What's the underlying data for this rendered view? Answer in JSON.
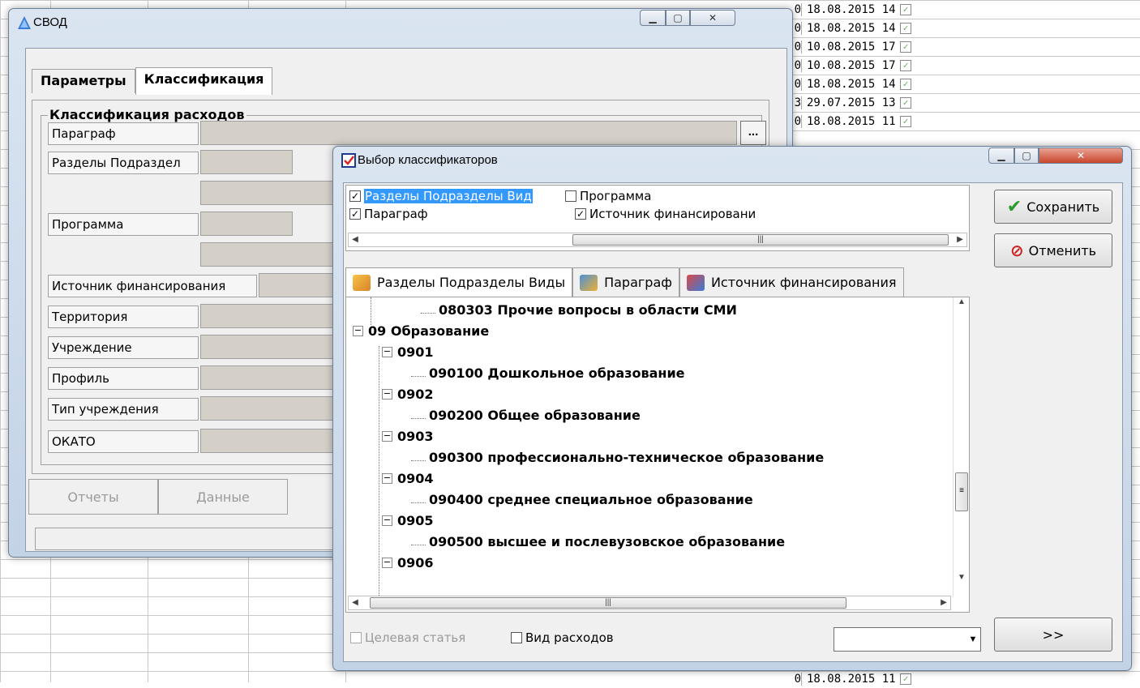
{
  "background": {
    "rows": [
      {
        "num": "0",
        "date": "18.08.2015 14"
      },
      {
        "num": "0",
        "date": "18.08.2015 14"
      },
      {
        "num": "0",
        "date": "10.08.2015 17"
      },
      {
        "num": "0",
        "date": "10.08.2015 17"
      },
      {
        "num": "0",
        "date": "18.08.2015 14"
      },
      {
        "num": "3",
        "date": "29.07.2015 13"
      },
      {
        "num": "0",
        "date": "18.08.2015 11"
      }
    ],
    "bottom_row": {
      "num": "0",
      "date": "18.08.2015 11"
    }
  },
  "svod": {
    "title": "СВОД",
    "tabs": [
      "Параметры",
      "Классификация"
    ],
    "group_title": "Классификация расходов",
    "fields": {
      "paragraph": "Параграф",
      "sections": "Разделы Подраздел",
      "program": "Программа",
      "source": "Источник финансирования",
      "territory": "Территория",
      "institution": "Учреждение",
      "profile": "Профиль",
      "inst_type": "Тип учреждения",
      "okato": "ОКАТО"
    },
    "dots": "...",
    "bottom_buttons": {
      "reports": "Отчеты",
      "data": "Данные"
    }
  },
  "vybor": {
    "title": "Выбор классификаторов",
    "checks": {
      "sections": "Разделы Подразделы Вид",
      "program": "Программа",
      "paragraph": "Параграф",
      "source": "Источник финансировани"
    },
    "tabs": [
      "Разделы Подразделы Виды",
      "Параграф",
      "Источник финансирования"
    ],
    "tree": {
      "n080303": "080303 Прочие вопросы в области СМИ",
      "n09": "09 Образование",
      "n0901": "0901",
      "n090100": "090100 Дошкольное образование",
      "n0902": "0902",
      "n090200": "090200 Общее образование",
      "n0903": "0903",
      "n090300": "090300 профессионально-техническое образование",
      "n0904": "0904",
      "n090400": "090400 среднее специальное образование",
      "n0905": "0905",
      "n090500": "090500 высшее и послевузовское образование",
      "n0906": "0906"
    },
    "save": "Сохранить",
    "cancel": "Отменить",
    "more": ">>",
    "bottom_checks": {
      "target": "Целевая статья",
      "expense": "Вид расходов"
    },
    "combo_value": ""
  },
  "icons": {
    "svod_icon": "triangle-app-icon",
    "vybor_icon": "checkbox-list-app-icon"
  }
}
